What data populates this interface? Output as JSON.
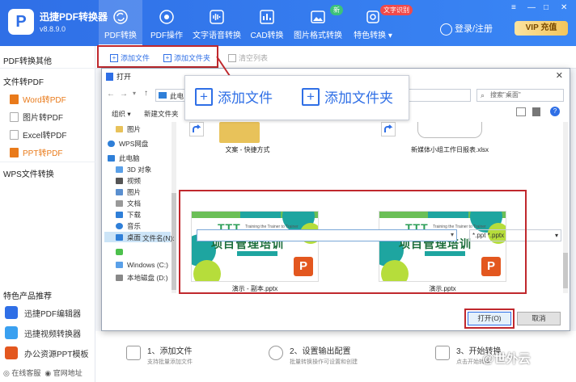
{
  "app": {
    "name": "迅捷PDF转换器",
    "version": "v8.8.9.0",
    "logo": "P"
  },
  "nav": [
    {
      "label": "PDF转换",
      "icon": "refresh-icon",
      "active": true
    },
    {
      "label": "PDF操作",
      "icon": "target-icon"
    },
    {
      "label": "文字语音转换",
      "icon": "soundwave-icon"
    },
    {
      "label": "CAD转换",
      "icon": "bar-chart-icon"
    },
    {
      "label": "图片格式转换",
      "icon": "image-icon",
      "badge": "新"
    },
    {
      "label": "特色转换",
      "icon": "gear-icon",
      "badge": "文字识别"
    }
  ],
  "header": {
    "login": "登录/注册",
    "vip": "VIP 充值",
    "win_controls": [
      "≡",
      "—",
      "□",
      "✕"
    ]
  },
  "sidebar": {
    "group1": "PDF转换其他",
    "group2": "文件转PDF",
    "items": [
      "Word转PDF",
      "图片转PDF",
      "Excel转PDF",
      "PPT转PDF"
    ],
    "group3": "WPS文件转换",
    "features_title": "特色产品推荐",
    "features": [
      "迅捷PDF编辑器",
      "迅捷视频转换器",
      "办公资源PPT模板"
    ],
    "footer": [
      "在线客服",
      "官网地址"
    ]
  },
  "toolbar": {
    "add_file": "添加文件",
    "add_folder": "添加文件夹",
    "clear_list": "清空列表"
  },
  "dialog": {
    "title": "打开",
    "address": "此电",
    "search_placeholder": "搜索\"桌面\"",
    "organize": "组织 ▾",
    "new_folder": "新建文件夹",
    "tree": [
      "图片",
      "WPS网盘",
      "此电脑",
      "3D 对象",
      "视频",
      "图片",
      "文档",
      "下载",
      "音乐",
      "桌面",
      "",
      "Windows (C:)",
      "本地磁盘 (D:)"
    ],
    "files_top": [
      "文案 - 快捷方式",
      "新媒体小组工作日报表.xlsx"
    ],
    "slides": [
      {
        "name": "演示 - 副本.pptx",
        "ttt": "TTT",
        "sub": "Training the Trainer to Trainer",
        "title": "项目管理培训",
        "badge": "P"
      },
      {
        "name": "演示.pptx",
        "ttt": "TTT",
        "sub": "Training the Trainer to Trainer",
        "title": "项目管理培训",
        "badge": "P"
      }
    ],
    "filename_label": "文件名(N):",
    "filetype": "*.ppt *.pptx",
    "open": "打开(O)",
    "cancel": "取消"
  },
  "callout": {
    "add_file": "添加文件",
    "add_folder": "添加文件夹"
  },
  "steps": [
    {
      "label": "1、添加文件",
      "sub": "支持批量添加文件"
    },
    {
      "label": "2、设置输出配置",
      "sub": "批量转换操作可设置和创建"
    },
    {
      "label": "3、开始转换",
      "sub": "点击开始转换"
    }
  ],
  "watermark": "@世外云",
  "colors": {
    "brand": "#2f6fe6",
    "accent": "#e97a1a",
    "highlight": "#c0282d"
  }
}
